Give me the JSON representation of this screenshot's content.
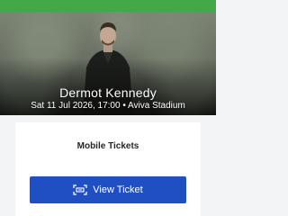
{
  "colors": {
    "top_bar": "#43a847",
    "button": "#1f4fc3",
    "page_background": "#f3f4f6"
  },
  "event": {
    "artist": "Dermot Kennedy",
    "details": "Sat 11 Jul 2026, 17:00 • Aviva Stadium",
    "image": "performer-photo"
  },
  "tickets": {
    "label": "Mobile Tickets",
    "button_label": "View Ticket",
    "button_icon": "ticket-scan-icon"
  }
}
